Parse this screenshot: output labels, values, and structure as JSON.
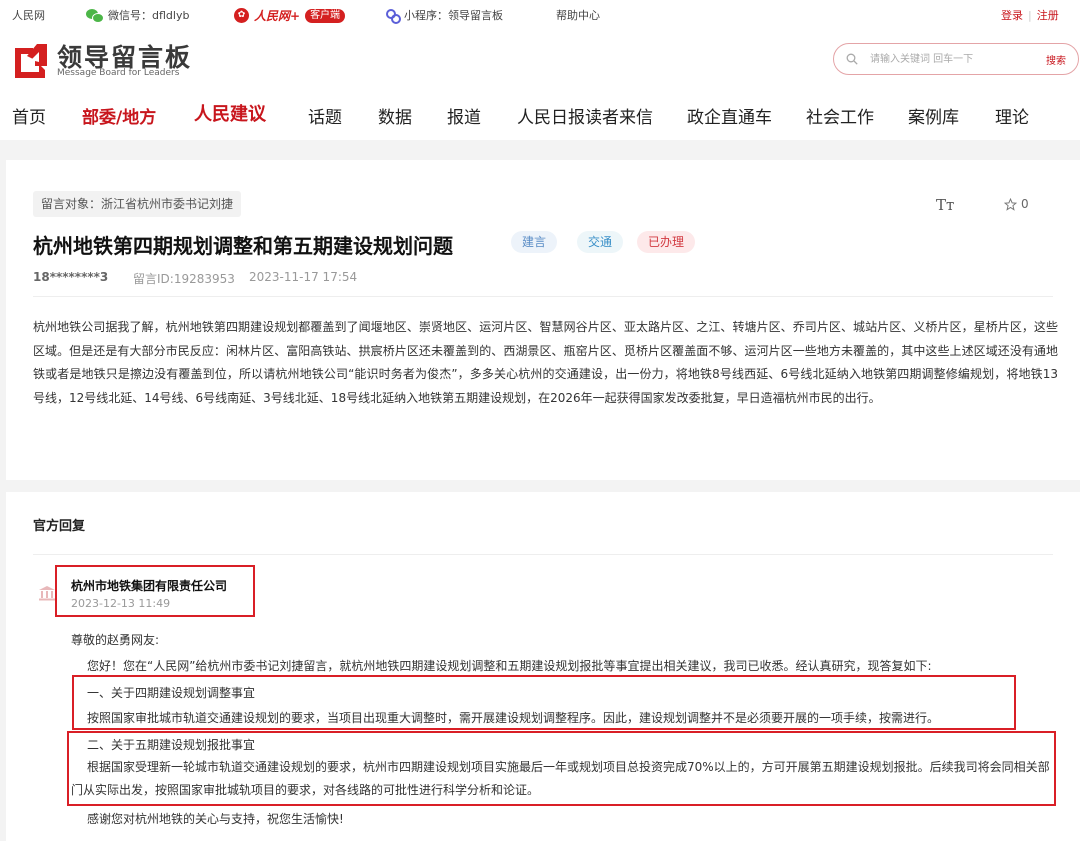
{
  "topbar": {
    "rmw": "人民网",
    "wechat": "微信号：dfldlyb",
    "app_name": "人民网+",
    "app_badge": "客户端",
    "miniprogram": "小程序：领导留言板",
    "help": "帮助中心",
    "login": "登录",
    "sep": "|",
    "register": "注册"
  },
  "header": {
    "logo_title": "领导留言板",
    "logo_sub": "Message Board for Leaders",
    "search_placeholder": "请输入关键词 回车一下",
    "search_button": "搜索"
  },
  "nav": [
    "首页",
    "部委/地方",
    "人民建议",
    "话题",
    "数据",
    "报道",
    "人民日报读者来信",
    "政企直通车",
    "社会工作",
    "案例库",
    "理论"
  ],
  "message": {
    "target": "留言对象：浙江省杭州市委书记刘捷",
    "title": "杭州地铁第四期规划调整和第五期建设规划问题",
    "tags": [
      "建言",
      "交通",
      "已办理"
    ],
    "font_icon": "Tт",
    "fav_count": "0",
    "user": "18********3",
    "id": "留言ID:19283953",
    "time": "2023-11-17 17:54",
    "body": "杭州地铁公司据我了解，杭州地铁第四期建设规划都覆盖到了闻堰地区、崇贤地区、运河片区、智慧网谷片区、亚太路片区、之江、转塘片区、乔司片区、城站片区、义桥片区，星桥片区，这些区域。但是还是有大部分市民反应：闲林片区、富阳高铁站、拱宸桥片区还未覆盖到的、西湖景区、瓶窑片区、觅桥片区覆盖面不够、运河片区一些地方未覆盖的，其中这些上述区域还没有通地铁或者是地铁只是擦边没有覆盖到位，所以请杭州地铁公司“能识时务者为俊杰”，多多关心杭州的交通建设，出一份力，将地铁8号线西延、6号线北延纳入地铁第四期调整修编规划，将地铁13号线，12号线北延、14号线、6号线南延、3号线北延、18号线北延纳入地铁第五期建设规划，在2026年一起获得国家发改委批复，早日造福杭州市民的出行。"
  },
  "reply": {
    "heading": "官方回复",
    "org": "杭州市地铁集团有限责任公司",
    "date": "2023-12-13 11:49",
    "greeting": "尊敬的赵勇网友:",
    "intro": "您好！您在“人民网”给杭州市委书记刘捷留言，就杭州地铁四期建设规划调整和五期建设规划报批等事宜提出相关建议，我司已收悉。经认真研究，现答复如下:",
    "s1_title": "一、关于四期建设规划调整事宜",
    "s1_body": "按照国家审批城市轨道交通建设规划的要求，当项目出现重大调整时，需开展建设规划调整程序。因此，建设规划调整并不是必须要开展的一项手续，按需进行。",
    "s2_title": "二、关于五期建设规划报批事宜",
    "s2_body": "根据国家受理新一轮城市轨道交通建设规划的要求，杭州市四期建设规划项目实施最后一年或规划项目总投资完成70%以上的，方可开展第五期建设规划报批。后续我司将会同相关部门从实际出发，按照国家审批城轨项目的要求，对各线路的可批性进行科学分析和论证。",
    "closing": "感谢您对杭州地铁的关心与支持，祝您生活愉快!"
  },
  "colors": {
    "brand_red": "#c8161d",
    "highlight_box": "#d91f26"
  }
}
